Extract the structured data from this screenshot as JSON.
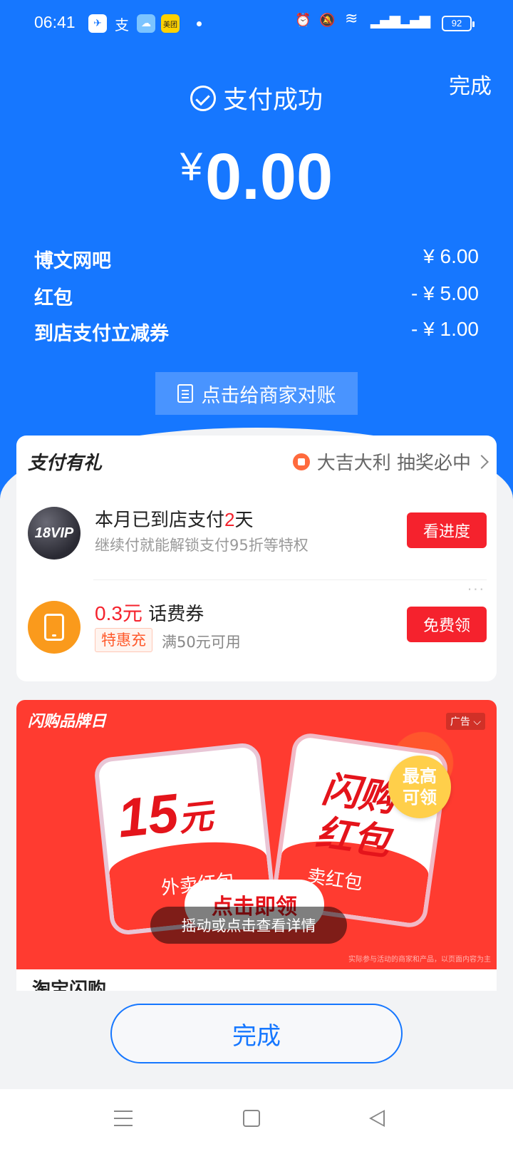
{
  "status_bar": {
    "time": "06:41",
    "battery": "92",
    "app_icons": [
      "bird-app-icon",
      "alipay-icon",
      "weather-icon",
      "meituan-icon"
    ],
    "meituan_label": "美团",
    "alipay_glyph": "支",
    "right_icons": [
      "alarm-icon",
      "mute-icon",
      "wifi-icon",
      "signal-4g-icon",
      "signal-4g-icon"
    ]
  },
  "header": {
    "done_label": "完成",
    "success_label": "支付成功",
    "currency": "¥",
    "amount": "0.00"
  },
  "details": [
    {
      "label": "博文网吧",
      "value": "¥ 6.00"
    },
    {
      "label": "红包",
      "value": "- ¥ 5.00"
    },
    {
      "label": "到店支付立减券",
      "value": "- ¥ 1.00"
    }
  ],
  "reconcile_button": "点击给商家对账",
  "rewards": {
    "title": "支付有礼",
    "lottery": "大吉大利 抽奖必中",
    "vip": {
      "badge": "18VIP",
      "title_prefix": "本月已到店支付",
      "days": "2",
      "title_suffix": "天",
      "subtitle": "继续付就能解锁支付95折等特权",
      "button": "看进度"
    },
    "phone": {
      "amount": "0.3元",
      "title": "话费券",
      "tag": "特惠充",
      "condition": "满50元可用",
      "button": "免费领"
    },
    "more": "···"
  },
  "ad": {
    "brand": "闪购品牌日",
    "label": "广告",
    "left_card_amount": "15",
    "left_card_unit": "元",
    "left_card_sub": "外卖红包",
    "right_card_line1": "闪购",
    "right_card_line2": "红包",
    "right_card_sub": "卖红包",
    "max_badge_line1": "最高",
    "max_badge_line2": "可领",
    "claim": "点击即领",
    "shake_tip": "摇动或点击查看详情",
    "disclaimer": "实际参与活动的商家和产品，以页面内容为主"
  },
  "next_section_peek": "淘宝闪购",
  "done_button": "完成",
  "colors": {
    "primary_blue": "#1677ff",
    "accent_red": "#f5222d",
    "background": "#f2f3f5"
  }
}
